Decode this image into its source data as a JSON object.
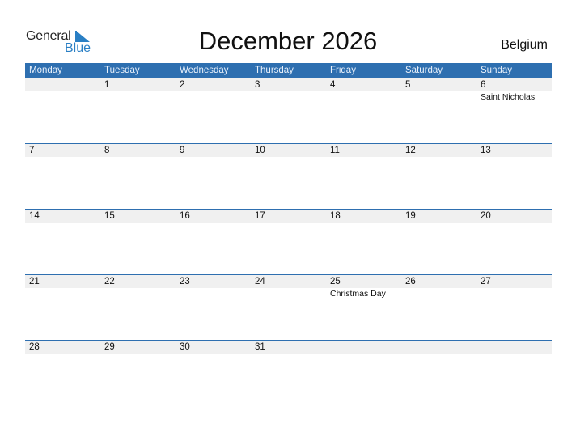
{
  "logo": {
    "word1": "General",
    "word2": "Blue"
  },
  "title": "December 2026",
  "country": "Belgium",
  "colors": {
    "header": "#2e6fb0",
    "brand": "#2a7fc4",
    "date_strip": "#f0f0f0"
  },
  "weekdays": [
    "Monday",
    "Tuesday",
    "Wednesday",
    "Thursday",
    "Friday",
    "Saturday",
    "Sunday"
  ],
  "weeks": [
    [
      {
        "day": ""
      },
      {
        "day": "1"
      },
      {
        "day": "2"
      },
      {
        "day": "3"
      },
      {
        "day": "4"
      },
      {
        "day": "5"
      },
      {
        "day": "6",
        "holiday": "Saint Nicholas"
      }
    ],
    [
      {
        "day": "7"
      },
      {
        "day": "8"
      },
      {
        "day": "9"
      },
      {
        "day": "10"
      },
      {
        "day": "11"
      },
      {
        "day": "12"
      },
      {
        "day": "13"
      }
    ],
    [
      {
        "day": "14"
      },
      {
        "day": "15"
      },
      {
        "day": "16"
      },
      {
        "day": "17"
      },
      {
        "day": "18"
      },
      {
        "day": "19"
      },
      {
        "day": "20"
      }
    ],
    [
      {
        "day": "21"
      },
      {
        "day": "22"
      },
      {
        "day": "23"
      },
      {
        "day": "24"
      },
      {
        "day": "25",
        "holiday": "Christmas Day"
      },
      {
        "day": "26"
      },
      {
        "day": "27"
      }
    ],
    [
      {
        "day": "28"
      },
      {
        "day": "29"
      },
      {
        "day": "30"
      },
      {
        "day": "31"
      },
      {
        "day": ""
      },
      {
        "day": ""
      },
      {
        "day": ""
      }
    ]
  ]
}
